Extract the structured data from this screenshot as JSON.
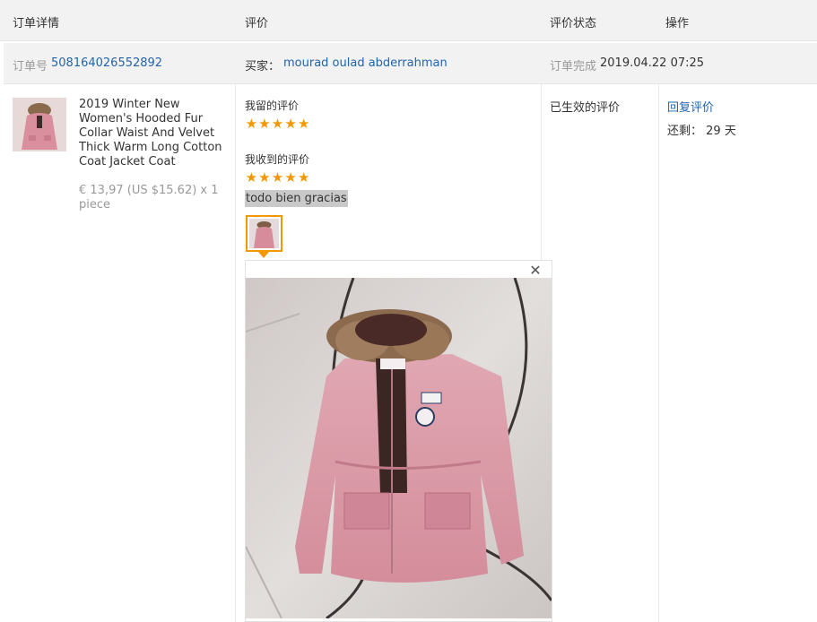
{
  "headers": {
    "order_details": "订单详情",
    "review": "评价",
    "review_status": "评价状态",
    "actions": "操作"
  },
  "order": {
    "order_no_label": "订单号",
    "order_no": "508164026552892",
    "buyer_label": "买家：",
    "buyer_name": "mourad oulad abderrahman",
    "completed_label": "订单完成",
    "completed_time": "2019.04.22 07:25"
  },
  "product": {
    "image_icon": "pink-hooded-coat-photo",
    "title": "2019 Winter New Women's Hooded Fur Collar Waist And Velvet Thick Warm Long Cotton Coat Jacket Coat",
    "price": "€ 13,97 (US $15.62) x 1 piece"
  },
  "review": {
    "my_review_label": "我留的评价",
    "my_rating": 5,
    "received_review_label": "我收到的评价",
    "received_rating": 5,
    "received_text": "todo bien gracias",
    "star_color": "#f39800",
    "thumb_icon": "review-photo-thumbnail",
    "close_icon": "close-icon"
  },
  "status": {
    "text": "已生效的评价"
  },
  "actions": {
    "reply_label": "回复评价",
    "remaining_label": "还剩：",
    "remaining_value": "29 天"
  },
  "colors": {
    "link": "#2264a8",
    "accent": "#f39800",
    "header_bg": "#f2f2f2"
  }
}
